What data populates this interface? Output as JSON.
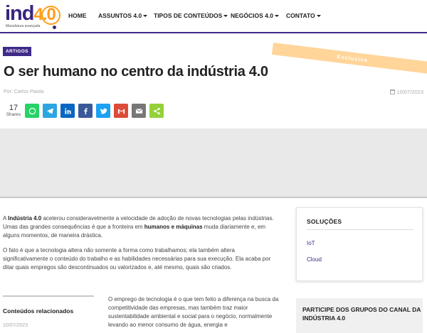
{
  "logo": {
    "main": "ind",
    "suffix": "4.0",
    "tagline": "Manufatura avançada"
  },
  "nav": [
    {
      "label": "HOME",
      "dropdown": false
    },
    {
      "label": "ASSUNTOS 4.0",
      "dropdown": true
    },
    {
      "label": "TIPOS DE CONTEÚDOS",
      "dropdown": true
    },
    {
      "label": "NEGÓCIOS 4.0",
      "dropdown": true
    },
    {
      "label": "CONTATO",
      "dropdown": true
    }
  ],
  "article": {
    "tag": "ARTIGOS",
    "exclusive": "Exclusive",
    "title": "O ser humano no centro da indústria 4.0",
    "byline": "Por: Carlos Paiola",
    "date": "10/07/2023",
    "shares_count": "17",
    "shares_label": "Shares"
  },
  "share_buttons": [
    {
      "name": "whatsapp",
      "color": "#25d366"
    },
    {
      "name": "telegram",
      "color": "#2ca5e0"
    },
    {
      "name": "linkedin",
      "color": "#0a66c2"
    },
    {
      "name": "facebook",
      "color": "#3b5998"
    },
    {
      "name": "twitter",
      "color": "#1da1f2"
    },
    {
      "name": "gmail",
      "color": "#dd4b39"
    },
    {
      "name": "email",
      "color": "#777777"
    },
    {
      "name": "sharethis",
      "color": "#95d03a"
    }
  ],
  "body": {
    "p1_a": "A ",
    "p1_b": "Indústria 4.0",
    "p1_c": " acelerou consideravelmente a velocidade de adoção de novas tecnologias pelas indústrias. Umas das grandes consequências é que a fronteira em ",
    "p1_d": "humanos e máquinas",
    "p1_e": " muda diariamente e, em alguns momentos, de maneira drástica.",
    "p2": "O fato é que a tecnologia altera não somente a forma como trabalhamos; ela também altera significativamente o conteúdo do trabalho e as habilidades necessárias para sua execução. Ela acaba por ditar quais empregos são descontinuados ou valorizados e, até mesmo, quais são criados.",
    "p3": "O emprego de tecnologia é o que tem feito a diferença na busca da competitividade das empresas, mas também traz maior sustentabilidade ambiental e social para o negócio, normalmente levando ao menor consumo de água, energia e"
  },
  "related": {
    "title": "Conteúdos relacionados",
    "date": "10/07/2023"
  },
  "sidebar": {
    "solutions_title": "SOLUÇÕES",
    "links": [
      "IoT",
      "Cloud"
    ],
    "groups_title": "PARTICIPE DOS GRUPOS DO CANAL DA INDÚSTRIA 4.0"
  },
  "colors": {
    "brand": "#3f2a87",
    "accent": "#ff9f1c",
    "exclusive_bg": "#ffd59a"
  }
}
